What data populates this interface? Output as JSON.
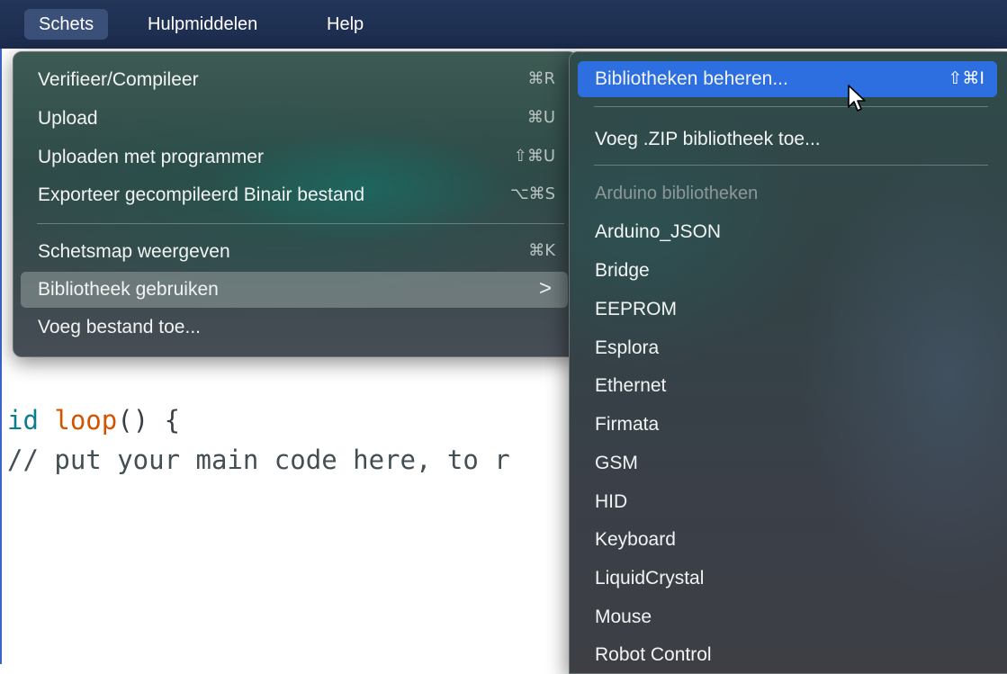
{
  "menubar": {
    "items": [
      {
        "label": "Schets"
      },
      {
        "label": "Hulpmiddelen"
      },
      {
        "label": "Help"
      }
    ]
  },
  "editor": {
    "line1": {
      "kw": "id",
      "fn": "loop",
      "rest": "() {"
    },
    "line2": "// put your main code here, to r"
  },
  "sketch_menu": {
    "items": [
      {
        "label": "Verifieer/Compileer",
        "shortcut": "⌘R"
      },
      {
        "label": "Upload",
        "shortcut": "⌘U"
      },
      {
        "label": "Uploaden met programmer",
        "shortcut": "⇧⌘U"
      },
      {
        "label": "Exporteer gecompileerd Binair bestand",
        "shortcut": "⌥⌘S"
      },
      {
        "label": "Schetsmap weergeven",
        "shortcut": "⌘K"
      },
      {
        "label": "Bibliotheek gebruiken",
        "submenu_arrow": ">"
      },
      {
        "label": "Voeg bestand toe..."
      }
    ]
  },
  "library_submenu": {
    "manage": {
      "label": "Bibliotheken beheren...",
      "shortcut": "⇧⌘I"
    },
    "add_zip": {
      "label": "Voeg .ZIP bibliotheek toe..."
    },
    "section_header": "Arduino bibliotheken",
    "libraries": [
      "Arduino_JSON",
      "Bridge",
      "EEPROM",
      "Esplora",
      "Ethernet",
      "Firmata",
      "GSM",
      "HID",
      "Keyboard",
      "LiquidCrystal",
      "Mouse",
      "Robot Control"
    ]
  }
}
